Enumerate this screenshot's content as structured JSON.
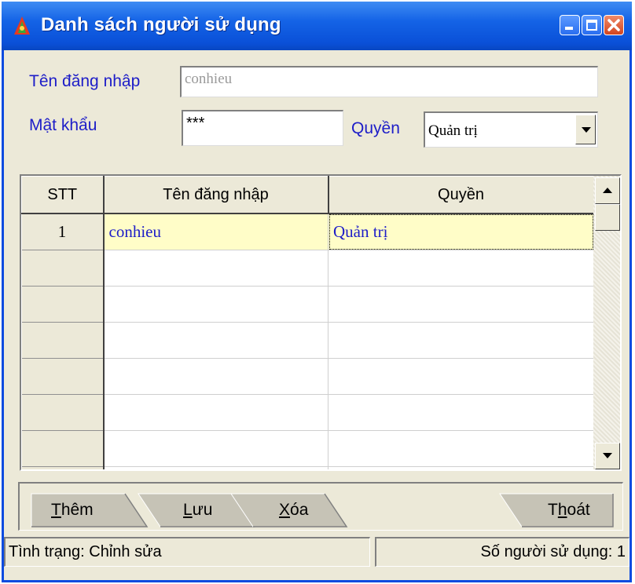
{
  "window": {
    "title": "Danh sách người sử dụng",
    "accent": "#0a4be0",
    "icon": "app-triangle-icon",
    "controls": [
      "minimize-icon",
      "maximize-icon",
      "close-icon"
    ]
  },
  "form": {
    "username_label": "Tên đăng nhập",
    "username_value": "conhieu",
    "password_label": "Mật khẩu",
    "password_value": "***",
    "role_label": "Quyền",
    "role_value": "Quản trị"
  },
  "grid": {
    "columns": [
      "STT",
      "Tên đăng nhập",
      "Quyền"
    ],
    "rows": [
      {
        "stt": "1",
        "username": "conhieu",
        "role": "Quản trị"
      }
    ],
    "selected_color": "#fffdc8"
  },
  "toolbar": {
    "add_first": "T",
    "add_rest": "hêm",
    "save_first": "L",
    "save_rest": "ưu",
    "delete_first": "X",
    "delete_rest": "óa",
    "exit_pre": "T",
    "exit_u": "h",
    "exit_rest": "oát"
  },
  "status": {
    "left": "Tình trạng: Chỉnh sửa",
    "right": "Số người sử dụng: 1"
  }
}
